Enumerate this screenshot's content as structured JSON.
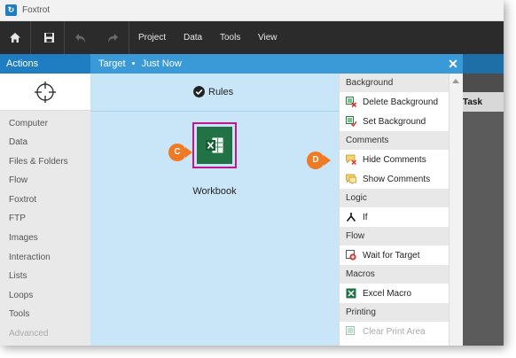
{
  "app": {
    "title": "Foxtrot",
    "icon": "foxtrot-app-icon"
  },
  "toolbar": {
    "buttons": [
      "home-icon",
      "save-icon",
      "undo-icon",
      "redo-icon"
    ],
    "menu": [
      "Project",
      "Data",
      "Tools",
      "View"
    ]
  },
  "actions_panel": {
    "title": "Actions",
    "crosshair_icon": "crosshair-icon",
    "items": [
      "Computer",
      "Data",
      "Files & Folders",
      "Flow",
      "Foxtrot",
      "FTP",
      "Images",
      "Interaction",
      "Lists",
      "Loops",
      "Tools",
      "Advanced"
    ]
  },
  "target_panel": {
    "title": "Target",
    "separator": "•",
    "subtitle": "Just Now",
    "close_label": "✕",
    "rules_label": "Rules",
    "target_item_label": "Workbook",
    "callouts": [
      "C",
      "D"
    ]
  },
  "action_list": {
    "sections": [
      {
        "title": "Background",
        "items": [
          {
            "label": "Delete Background",
            "icon": "delete-background-icon"
          },
          {
            "label": "Set Background",
            "icon": "set-background-icon"
          }
        ]
      },
      {
        "title": "Comments",
        "items": [
          {
            "label": "Hide Comments",
            "icon": "hide-comments-icon"
          },
          {
            "label": "Show Comments",
            "icon": "show-comments-icon"
          }
        ]
      },
      {
        "title": "Logic",
        "items": [
          {
            "label": "If",
            "icon": "if-logic-icon"
          }
        ]
      },
      {
        "title": "Flow",
        "items": [
          {
            "label": "Wait for Target",
            "icon": "wait-for-target-icon"
          }
        ]
      },
      {
        "title": "Macros",
        "items": [
          {
            "label": "Excel Macro",
            "icon": "excel-macro-icon"
          }
        ]
      },
      {
        "title": "Printing",
        "items": [
          {
            "label": "Clear Print Area",
            "icon": "clear-print-area-icon"
          }
        ]
      }
    ]
  },
  "background_view": {
    "task_header": "Task"
  },
  "colors": {
    "accent": "#1f7ec2",
    "target_header": "#3a9ad8",
    "canvas": "#c8e6f7",
    "highlight_border": "#c2168e",
    "callout": "#f07a23",
    "excel_green": "#217346"
  }
}
